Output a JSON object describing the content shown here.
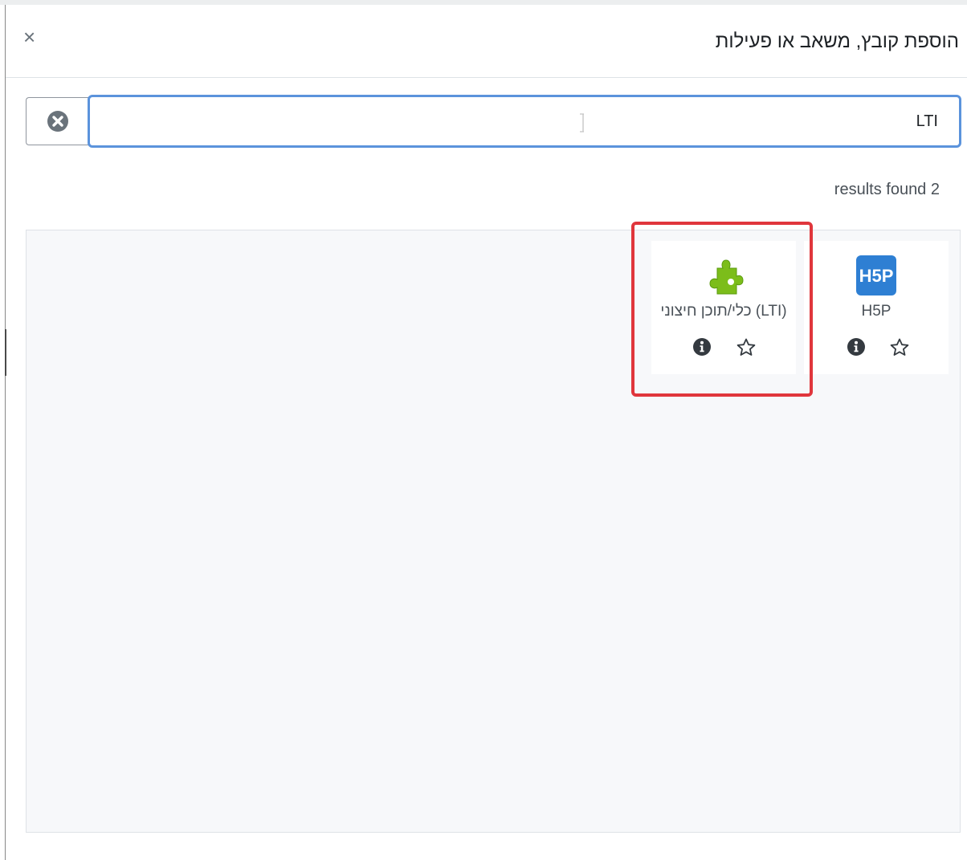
{
  "dialog": {
    "title": "הוספת קובץ, משאב או פעילות",
    "close_symbol": "×"
  },
  "search": {
    "value": "LTI",
    "clear_icon": "times-circle-icon"
  },
  "results": {
    "count_text": "results found 2",
    "items": [
      {
        "label": "H5P",
        "icon": "h5p-logo-icon",
        "icon_text": "H5P",
        "icon_color": "#2e7fd3"
      },
      {
        "label": "כלי/תוכן חיצוני (LTI)",
        "icon": "puzzle-piece-icon",
        "icon_color": "#7cbd1a"
      }
    ]
  },
  "colors": {
    "search_focus_border": "#5b93dc",
    "highlight_border": "#e0363c",
    "panel_background": "#f7f8fa"
  }
}
